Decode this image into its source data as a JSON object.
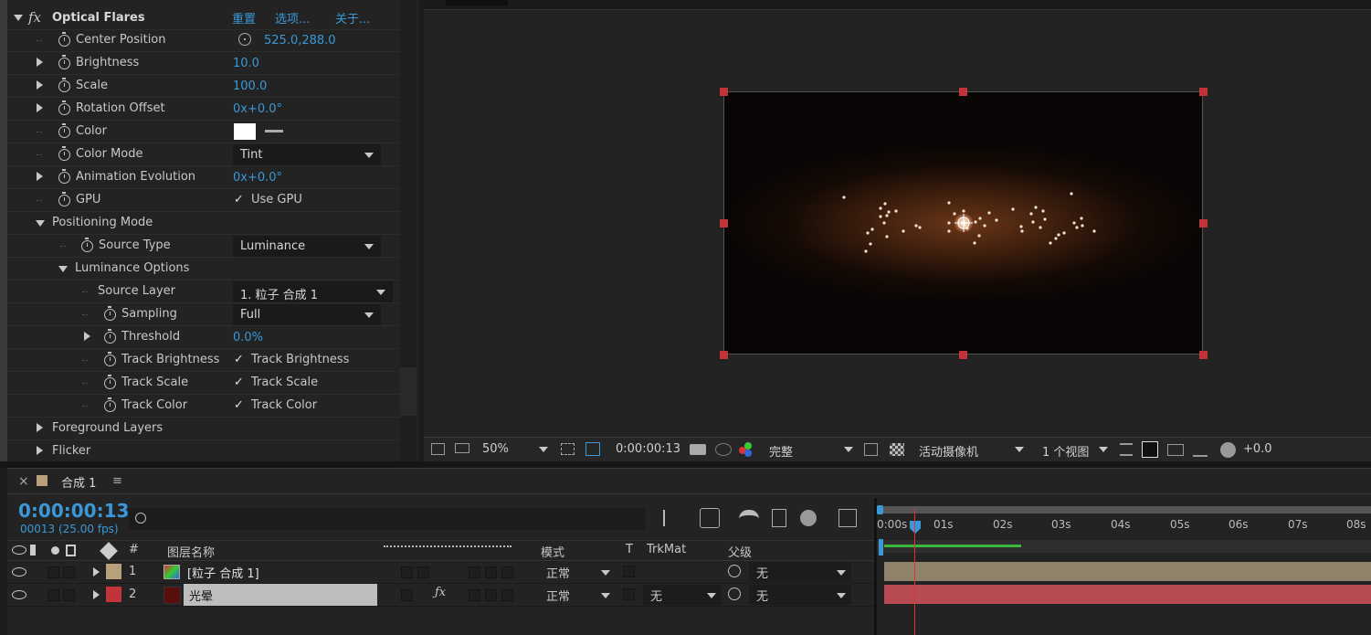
{
  "effect": {
    "name": "Optical Flares",
    "fx_icon": "fx",
    "links": [
      "重置",
      "选项...",
      "关于..."
    ],
    "rows": [
      {
        "label": "Center Position",
        "value": "525.0,288.0",
        "kind": "position"
      },
      {
        "label": "Brightness",
        "value": "10.0",
        "kind": "number"
      },
      {
        "label": "Scale",
        "value": "100.0",
        "kind": "number"
      },
      {
        "label": "Rotation Offset",
        "value": "0x+0.0°",
        "kind": "number"
      },
      {
        "label": "Color",
        "value": "#ffffff",
        "kind": "color"
      },
      {
        "label": "Color Mode",
        "value": "Tint",
        "kind": "dropdown"
      },
      {
        "label": "Animation Evolution",
        "value": "0x+0.0°",
        "kind": "number"
      },
      {
        "label": "GPU",
        "value": "Use GPU",
        "kind": "checkbox"
      }
    ],
    "positioning_mode": "Positioning Mode",
    "source_type": {
      "label": "Source Type",
      "value": "Luminance"
    },
    "luminance_options": "Luminance Options",
    "source_layer": {
      "label": "Source Layer",
      "value": "1. 粒子 合成 1"
    },
    "sampling": {
      "label": "Sampling",
      "value": "Full"
    },
    "threshold": {
      "label": "Threshold",
      "value": "0.0%"
    },
    "track_brightness": {
      "label": "Track Brightness",
      "value": "Track Brightness"
    },
    "track_scale": {
      "label": "Track Scale",
      "value": "Track Scale"
    },
    "track_color": {
      "label": "Track Color",
      "value": "Track Color"
    },
    "foreground_layers": "Foreground Layers",
    "flicker": "Flicker",
    "checkmark": "✓"
  },
  "viewer_bar": {
    "zoom": "50%",
    "timecode": "0:00:00:13",
    "resolution": "完整",
    "camera": "活动摄像机",
    "views": "1 个视图",
    "exposure": "+0.0"
  },
  "timeline": {
    "close": "×",
    "comp_name": "合成 1",
    "menu": "≡",
    "timecode": "0:00:00:13",
    "frame_info": "00013 (25.00 fps)",
    "search_placeholder": "",
    "columns": {
      "num": "#",
      "name": "图层名称",
      "mode": "模式",
      "t": "T",
      "trkmat": "TrkMat",
      "parent": "父级"
    },
    "layers": [
      {
        "num": "1",
        "name": "[粒子 合成 1]",
        "mode": "正常",
        "trkmat": "",
        "parent": "无",
        "label_color": "#b8a07a"
      },
      {
        "num": "2",
        "name": "光晕",
        "mode": "正常",
        "trkmat": "无",
        "parent": "无",
        "label_color": "#c0343a"
      }
    ],
    "ruler_ticks": [
      "0:00s",
      "01s",
      "02s",
      "03s",
      "04s",
      "05s",
      "06s",
      "07s",
      "08s"
    ]
  }
}
